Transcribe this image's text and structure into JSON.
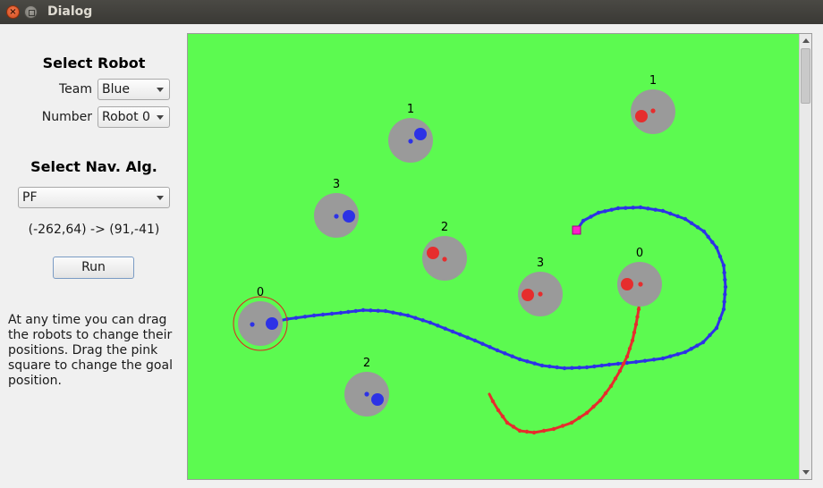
{
  "window": {
    "title": "Dialog",
    "close_glyph": "×"
  },
  "robot_select": {
    "heading": "Select Robot",
    "team_label": "Team",
    "team_value": "Blue",
    "number_label": "Number",
    "number_value": "Robot 0"
  },
  "nav_select": {
    "heading": "Select Nav. Alg.",
    "algorithm_value": "PF",
    "coords_text": "(-262,64) -> (91,-41)",
    "run_label": "Run"
  },
  "help_text": "At any time you can drag the robots to change their positions. Drag the pink square to change the goal position.",
  "field": {
    "colors": {
      "field": "#5cfa50",
      "robot_body": "#9a9a9a",
      "blue_team": "#2d32e6",
      "red_team": "#e62d2d",
      "goal": "#ff1ec8",
      "selection_ring": "#e02020"
    },
    "robots": [
      {
        "team": "blue",
        "label": "0",
        "selected": true
      },
      {
        "team": "blue",
        "label": "1"
      },
      {
        "team": "blue",
        "label": "2"
      },
      {
        "team": "blue",
        "label": "3"
      },
      {
        "team": "red",
        "label": "0"
      },
      {
        "team": "red",
        "label": "1"
      },
      {
        "team": "red",
        "label": "2"
      },
      {
        "team": "red",
        "label": "3"
      }
    ]
  }
}
